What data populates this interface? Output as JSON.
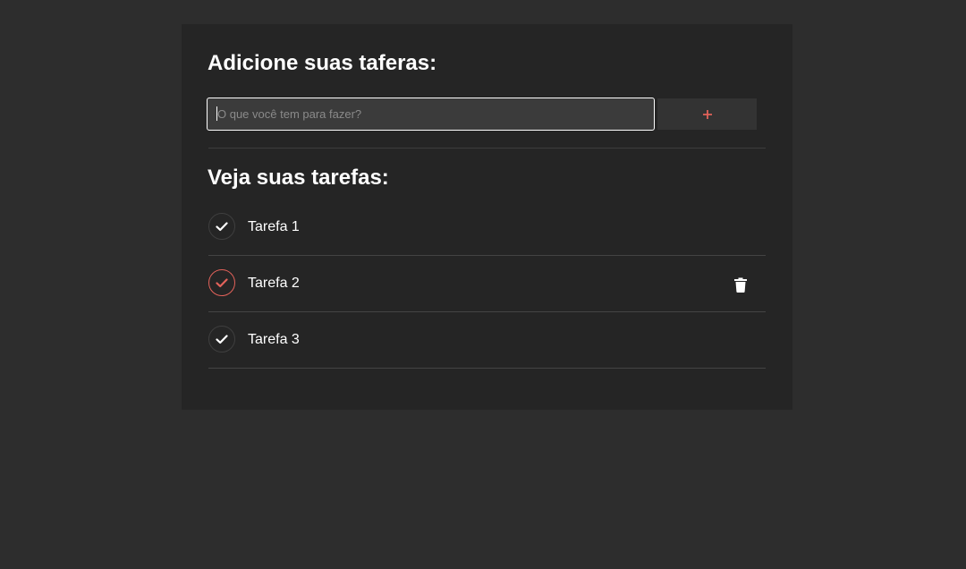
{
  "add_section": {
    "heading": "Adicione suas taferas:",
    "input_placeholder": "O que você tem para fazer?",
    "input_value": "",
    "add_button_icon": "plus-icon"
  },
  "list_section": {
    "heading": "Veja suas tarefas:",
    "tasks": [
      {
        "label": "Tarefa 1",
        "completed": false
      },
      {
        "label": "Tarefa 2",
        "completed": true,
        "delete_icon": "trash-icon"
      },
      {
        "label": "Tarefa 3",
        "completed": false
      }
    ]
  },
  "colors": {
    "page_background": "#2d2d2d",
    "card_background": "#252525",
    "accent": "#e2625a",
    "text": "#ffffff"
  }
}
